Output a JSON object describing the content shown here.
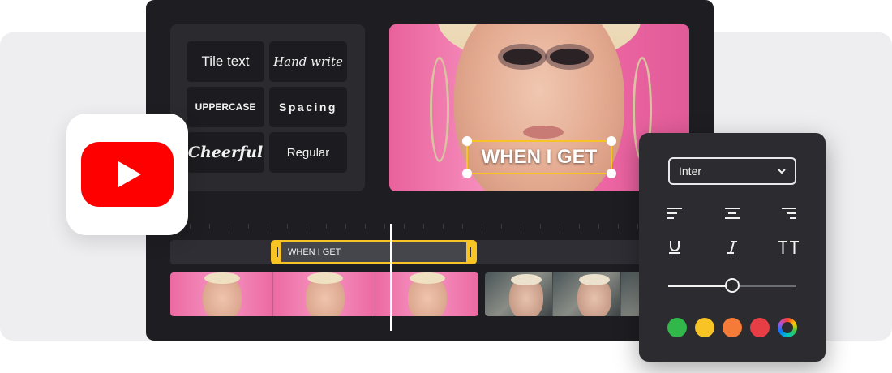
{
  "styles_panel": {
    "items": [
      {
        "label": "Tile text"
      },
      {
        "label": "Hand write"
      },
      {
        "label": "UPPERCASE"
      },
      {
        "label": "Spacing"
      },
      {
        "label": "Cheerful"
      },
      {
        "label": "Regular"
      }
    ]
  },
  "preview": {
    "caption": "WHEN I GET"
  },
  "timeline": {
    "text_clip_label": "WHEN I GET"
  },
  "format_panel": {
    "font": "Inter",
    "text_size_level": 0.5,
    "icons": [
      "align-left-icon",
      "align-center-icon",
      "align-right-icon",
      "underline-icon",
      "italic-icon",
      "text-size-icon"
    ],
    "colors": [
      "#31b74a",
      "#f7c325",
      "#f57c38",
      "#e63e44",
      "color-wheel"
    ]
  },
  "colors": {
    "accent": "#f7c325",
    "youtube_red": "#ff0000"
  }
}
